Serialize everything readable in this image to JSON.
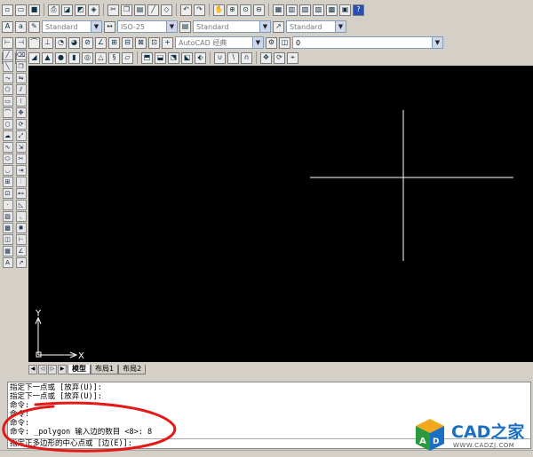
{
  "toolbar_row3": {
    "style_combo_1": "Standard",
    "dim_combo": "ISO-25",
    "style_combo_2": "Standard",
    "style_combo_3": "Standard"
  },
  "toolbar_row4": {
    "workspace_combo": "AutoCAD 经典",
    "layer_combo": "0"
  },
  "ucs": {
    "y_label": "Y",
    "x_label": "X"
  },
  "tabs": [
    {
      "label": "模型",
      "active": true
    },
    {
      "label": "布局1",
      "active": false
    },
    {
      "label": "布局2",
      "active": false
    }
  ],
  "command_history": [
    "指定下一点或 [放弃(U)]:",
    "指定下一点或 [放弃(U)]:",
    "命令:",
    "命令:",
    "命令:",
    "命令: _polygon 输入边的数目 <8>: 8"
  ],
  "command_input": "指定正多边形的中心点或 [边(E)]:",
  "logo": {
    "text": "CAD之家",
    "url": "WWW.CADZJ.COM",
    "color": "#1a6fc4"
  },
  "colors": {
    "canvas": "#000000",
    "crosshair": "#ffffff",
    "annotation": "#e51818"
  }
}
